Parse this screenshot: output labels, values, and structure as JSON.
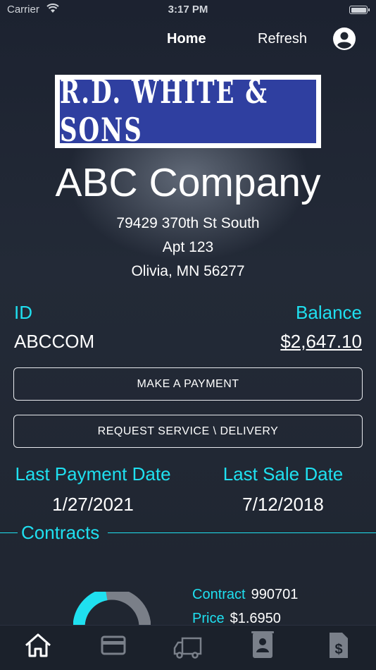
{
  "status_bar": {
    "carrier": "Carrier",
    "time": "3:17 PM"
  },
  "nav": {
    "home": "Home",
    "refresh": "Refresh",
    "profile_icon": "profile-icon"
  },
  "logo": {
    "text": "R.D. WHITE & SONS"
  },
  "company": {
    "name": "ABC Company",
    "address_line1": "79429 370th St South",
    "address_line2": "Apt 123",
    "address_line3": "Olivia, MN 56277"
  },
  "account": {
    "id_label": "ID",
    "id_value": "ABCCOM",
    "balance_label": "Balance",
    "balance_value": "$2,647.10"
  },
  "buttons": {
    "make_payment": "MAKE A PAYMENT",
    "request_service": "REQUEST SERVICE \\ DELIVERY"
  },
  "dates": {
    "last_payment_label": "Last Payment Date",
    "last_payment_value": "1/27/2021",
    "last_sale_label": "Last Sale Date",
    "last_sale_value": "7/12/2018"
  },
  "contracts": {
    "title": "Contracts",
    "contract_label": "Contract",
    "contract_value": "990701",
    "price_label": "Price",
    "price_value": "$1.6950"
  },
  "tabbar": {
    "tabs": [
      "home-icon",
      "card-icon",
      "truck-icon",
      "contact-icon",
      "invoice-icon"
    ]
  },
  "colors": {
    "accent": "#1fe0f0",
    "background": "#1f2530",
    "logo_blue": "#2f3fa0"
  }
}
